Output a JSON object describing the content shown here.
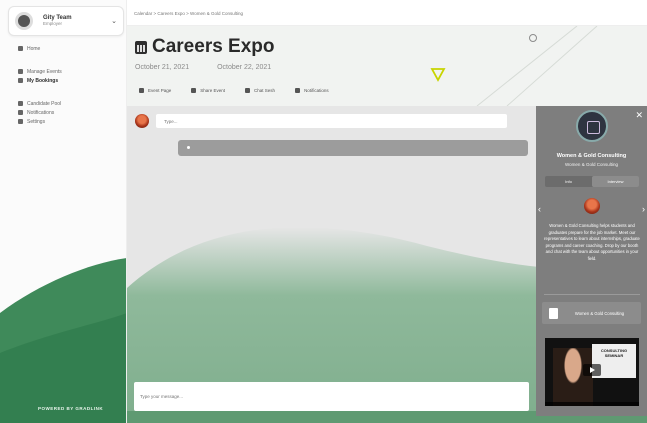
{
  "sidebar": {
    "profile": {
      "name": "Gity Team",
      "subtitle": "Employer"
    },
    "items": [
      {
        "label": "Home",
        "icon": "home-icon",
        "active": false
      },
      {
        "label": "Manage Events",
        "icon": "calendar-icon",
        "active": false
      },
      {
        "label": "My Bookings",
        "icon": "booking-icon",
        "active": true
      },
      {
        "label": "Candidate Pool",
        "icon": "people-icon",
        "active": false
      },
      {
        "label": "Notifications",
        "icon": "bell-icon",
        "active": false
      },
      {
        "label": "Settings",
        "icon": "gear-icon",
        "active": false
      }
    ],
    "brand": "POWERED BY GRADLINK"
  },
  "breadcrumb": "Calendar  >  Careers Expo  >  Women & Gold Consulting",
  "event": {
    "title": "Careers Expo",
    "start_date": "October 21, 2021",
    "end_date": "October 22, 2021",
    "actions": [
      {
        "label": "Event Page",
        "icon": "page-icon"
      },
      {
        "label": "Share Event",
        "icon": "share-icon"
      },
      {
        "label": "Chat Sesh",
        "icon": "chat-icon"
      },
      {
        "label": "Notifications",
        "icon": "bell-icon"
      }
    ]
  },
  "feed": {
    "comment_placeholder": "Type...",
    "bottom_placeholder": "Type your message..."
  },
  "booth": {
    "name": "Women & Gold Consulting",
    "subtitle": "Women & Gold Consulting",
    "tabs": [
      {
        "label": "Info",
        "selected": false
      },
      {
        "label": "Interview",
        "selected": true
      }
    ],
    "description": "Women & Gold Consulting helps students and graduates prepare for the job market. Meet our representatives to learn about internships, graduate programs and career coaching. Drop by our booth and chat with the team about opportunities in your field.",
    "document_label": "Women & Gold Consulting",
    "video_sign": "CONSULTING SEMINAR"
  },
  "colors": {
    "accent_green": "#5a9e70",
    "panel_gray": "#7e7e7e",
    "yellow_marker": "#c8d400"
  }
}
